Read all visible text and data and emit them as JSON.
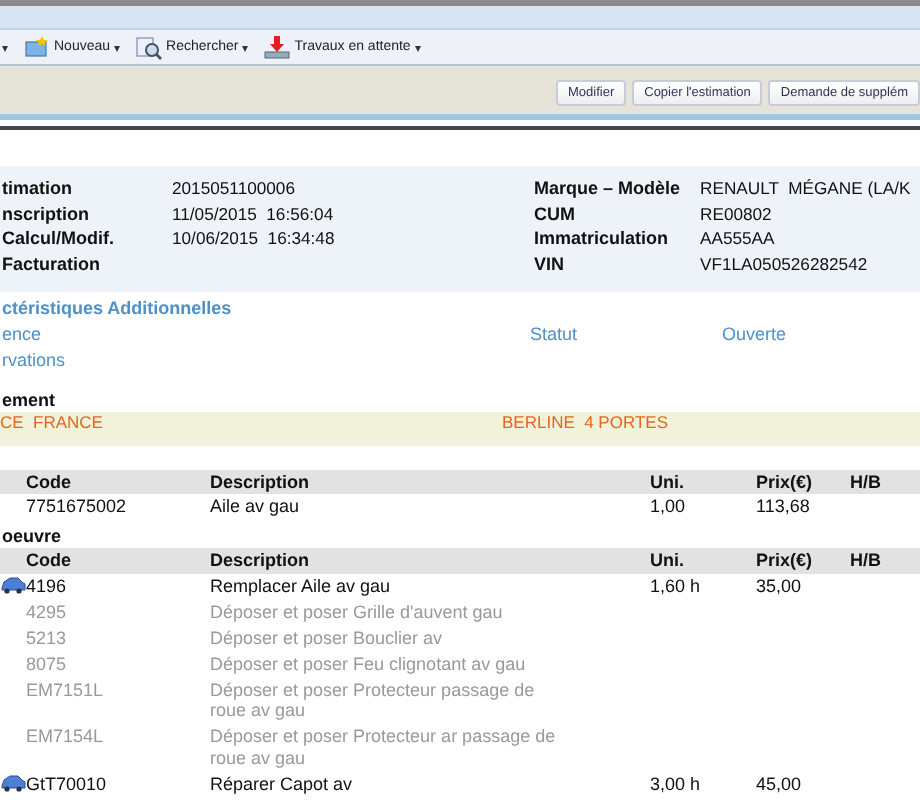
{
  "toolbar": {
    "leading_caret": "▾",
    "items": [
      {
        "label": "Nouveau",
        "caret": "▾"
      },
      {
        "label": "Rechercher",
        "caret": "▾"
      },
      {
        "label": "Travaux en attente",
        "caret": "▾"
      }
    ]
  },
  "actions": [
    "Modifier",
    "Copier l'estimation",
    "Demande de supplém"
  ],
  "info": {
    "left": [
      {
        "label": "timation",
        "value": "2015051100006"
      },
      {
        "label": "nscription",
        "value": "11/05/2015  16:56:04"
      },
      {
        "label": "Calcul/Modif.",
        "value": "10/06/2015  16:34:48"
      },
      {
        "label": "Facturation"
      }
    ],
    "right": [
      {
        "label": "Marque – Modèle",
        "value": "RENAULT  MÉGANE (LA/K"
      },
      {
        "label": "CUM",
        "value": "RE00802"
      },
      {
        "label": "Immatriculation",
        "value": "AA555AA"
      },
      {
        "label": "VIN",
        "value": "VF1LA050526282542"
      }
    ]
  },
  "additional": {
    "title": "ctéristiques Additionnelles",
    "rows": [
      {
        "label": "ence",
        "status_label": "Statut",
        "status_value": "Ouverte"
      },
      {
        "label": "rvations"
      }
    ]
  },
  "vehicle": {
    "title": "ement",
    "left": "CE  FRANCE",
    "right": "BERLINE  4 PORTES"
  },
  "parts": {
    "columns": [
      "Code",
      "Description",
      "Uni.",
      "Prix(€)",
      "H/B"
    ],
    "rows": [
      {
        "kind": "part",
        "code": "7751675002",
        "description": "Aile av gau",
        "unit": "1,00",
        "price": "113,68"
      }
    ]
  },
  "labour": {
    "title": "oeuvre",
    "columns": [
      "Code",
      "Description",
      "Uni.",
      "Prix(€)",
      "H/B"
    ],
    "rows": [
      {
        "kind": "operation",
        "code": "4196",
        "description": "Remplacer Aile av gau",
        "unit": "1,60 h",
        "price": "35,00"
      },
      {
        "kind": "sub",
        "code": "4295",
        "description": "Déposer et poser Grille d'auvent gau"
      },
      {
        "kind": "sub",
        "code": "5213",
        "description": "Déposer et poser Bouclier av"
      },
      {
        "kind": "sub",
        "code": "8075",
        "description": "Déposer et poser Feu clignotant av gau"
      },
      {
        "kind": "sub",
        "code": "EM7151L",
        "description": "Déposer et poser Protecteur passage de roue av gau"
      },
      {
        "kind": "sub",
        "code": "EM7154L",
        "description": "Déposer et poser Protecteur ar passage de roue av gau"
      },
      {
        "kind": "operation",
        "code": "GtT70010",
        "description": "Réparer Capot av",
        "unit": "3,00 h",
        "price": "45,00"
      }
    ]
  }
}
